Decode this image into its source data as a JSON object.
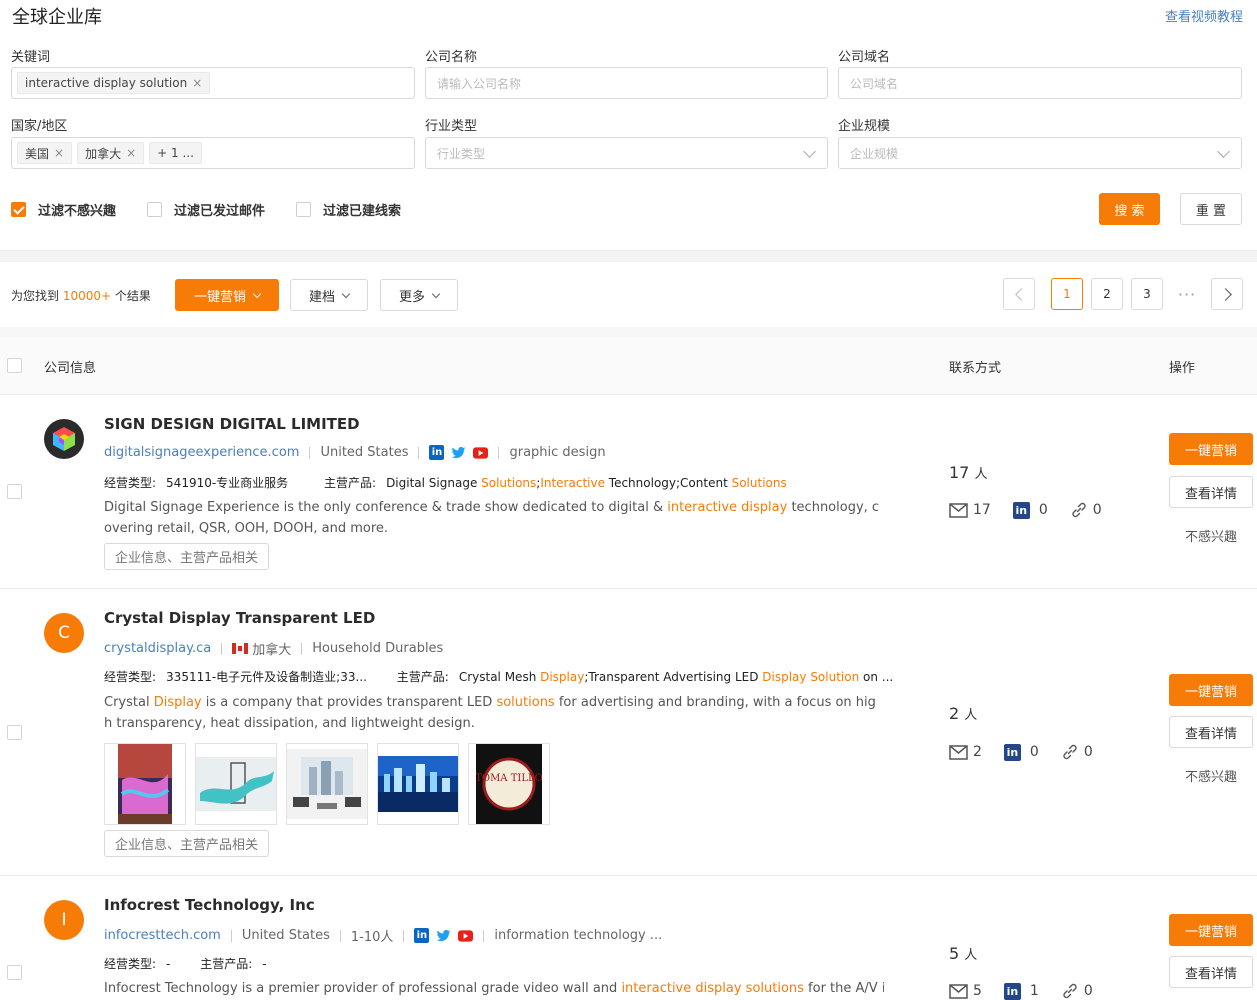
{
  "header": {
    "title": "全球企业库",
    "help_link": "查看视频教程"
  },
  "filters": {
    "keyword": {
      "label": "关键词",
      "tags": [
        "interactive display solution"
      ]
    },
    "company_name": {
      "label": "公司名称",
      "placeholder": "请输入公司名称"
    },
    "company_domain": {
      "label": "公司域名",
      "placeholder": "公司域名"
    },
    "country": {
      "label": "国家/地区",
      "tags": [
        "美国",
        "加拿大"
      ],
      "more": "+ 1 ..."
    },
    "industry": {
      "label": "行业类型",
      "placeholder": "行业类型"
    },
    "size": {
      "label": "企业规模",
      "placeholder": "企业规模"
    },
    "checkboxes": [
      {
        "label": "过滤不感兴趣",
        "checked": true
      },
      {
        "label": "过滤已发过邮件",
        "checked": false
      },
      {
        "label": "过滤已建线索",
        "checked": false
      }
    ],
    "search_button": "搜 索",
    "reset_button": "重 置"
  },
  "toolbar": {
    "result_prefix": "为您找到",
    "result_count": "10000+",
    "result_suffix": "个结果",
    "marketing_button": "一键营销",
    "archive_button": "建档",
    "more_button": "更多",
    "pagination": {
      "pages": [
        "1",
        "2",
        "3"
      ],
      "current": "1",
      "ellipsis": "···"
    }
  },
  "table": {
    "col_company": "公司信息",
    "col_contact": "联系方式",
    "col_action": "操作"
  },
  "labels": {
    "business_type": "经营类型:",
    "main_products": "主营产品:",
    "related_chip": "企业信息、主营产品相关",
    "people_unit": "人",
    "action_marketing": "一键营销",
    "action_detail": "查看详情",
    "action_not_interested": "不感兴趣"
  },
  "rows": [
    {
      "name": "SIGN DESIGN DIGITAL LIMITED",
      "domain": "digitalsignageexperience.com",
      "country": "United States",
      "industry": "graphic design",
      "business_type": "541910-专业商业服务",
      "products_parts": [
        "Digital Signage ",
        "Solutions",
        ";",
        "Interactive",
        " Technology;Content ",
        "Solutions"
      ],
      "desc_parts": [
        "Digital Signage Experience is the only conference & trade show dedicated to digital & ",
        "interactive display",
        " technology, covering retail, QSR, OOH, DOOH, and more."
      ],
      "people": "17",
      "emails": "17",
      "linkedin": "0",
      "links": "0"
    },
    {
      "name": "Crystal Display Transparent LED",
      "logo_letter": "C",
      "domain": "crystaldisplay.ca",
      "country": "加拿大",
      "industry": "Household Durables",
      "business_type": "335111-电子元件及设备制造业;33...",
      "products_parts": [
        "Crystal Mesh ",
        "Display",
        ";Transparent Advertising LED ",
        "Display Solution",
        " on ..."
      ],
      "desc_parts": [
        "Crystal ",
        "Display",
        " is a company that provides transparent LED ",
        "solutions",
        " for advertising and branding, with a focus on high transparency, heat dissipation, and lightweight design."
      ],
      "thumb_text": "TOMA TILLO",
      "people": "2",
      "emails": "2",
      "linkedin": "0",
      "links": "0"
    },
    {
      "name": "Infocrest Technology, Inc",
      "logo_letter": "I",
      "domain": "infocresttech.com",
      "country": "United States",
      "size": "1-10人",
      "industry": "information technology ...",
      "business_type": "-",
      "main_products": "-",
      "desc_parts": [
        "Infocrest Technology is a premier provider of professional grade video wall and ",
        "interactive display solutions",
        " for the A/V indust"
      ],
      "people": "5",
      "emails": "5",
      "linkedin": "1",
      "links": "0"
    }
  ],
  "colors": {
    "accent": "#f77b07",
    "link": "#4a7fc1",
    "linkedin": "#0a66c2"
  }
}
